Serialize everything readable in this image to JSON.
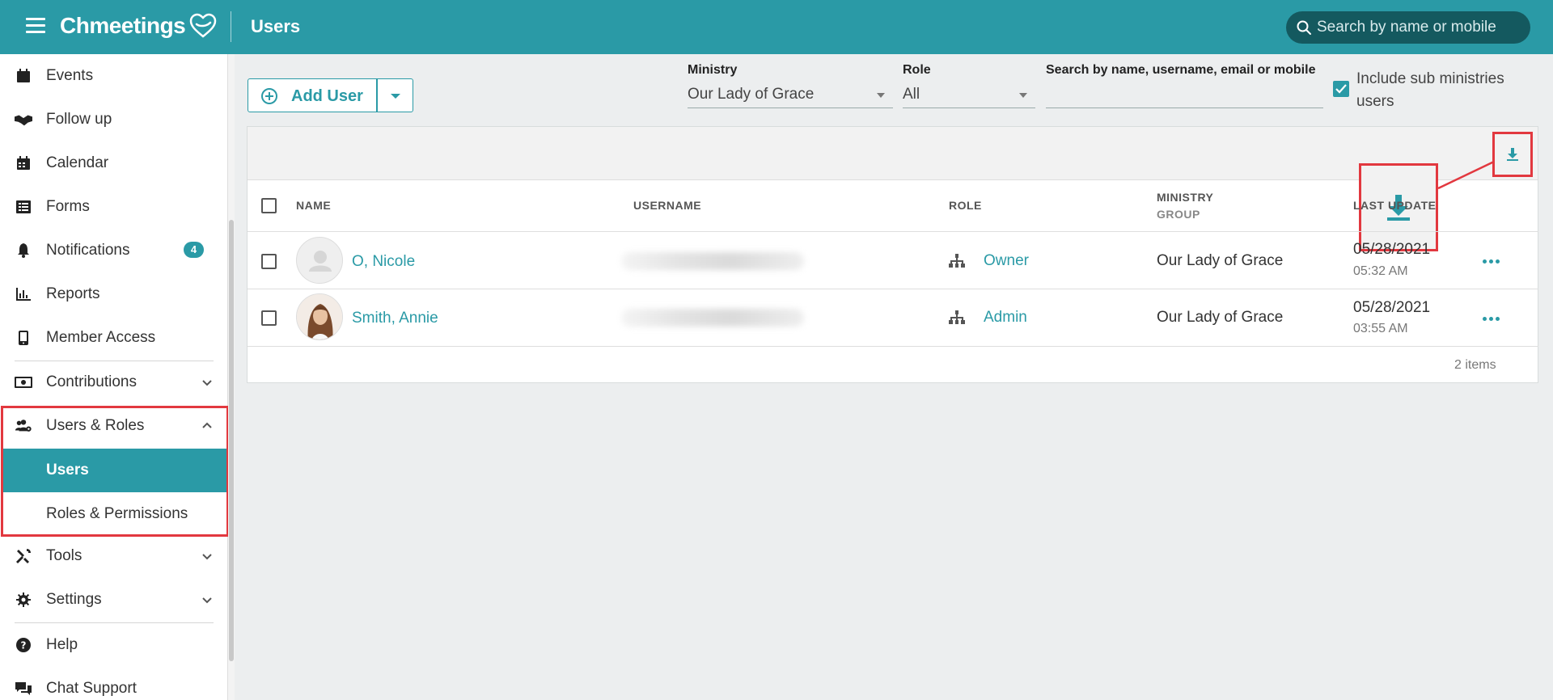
{
  "app": {
    "logo_text": "Chmeetings",
    "page_title": "Users",
    "search_placeholder": "Search by name or mobile"
  },
  "sidebar": {
    "items": [
      {
        "label": "Events",
        "icon": "calendar-page-icon"
      },
      {
        "label": "Follow up",
        "icon": "handshake-icon"
      },
      {
        "label": "Calendar",
        "icon": "calendar-icon"
      },
      {
        "label": "Forms",
        "icon": "form-list-icon"
      },
      {
        "label": "Notifications",
        "icon": "bell-icon",
        "badge": "4"
      },
      {
        "label": "Reports",
        "icon": "bar-chart-icon"
      },
      {
        "label": "Member Access",
        "icon": "mobile-phone-icon"
      },
      {
        "label": "Contributions",
        "icon": "money-icon"
      },
      {
        "label": "Users & Roles",
        "icon": "users-cog-icon"
      },
      {
        "label": "Tools",
        "icon": "tools-icon"
      },
      {
        "label": "Settings",
        "icon": "gear-icon"
      },
      {
        "label": "Help",
        "icon": "question-circle-icon"
      },
      {
        "label": "Chat Support",
        "icon": "chat-bubbles-icon"
      }
    ],
    "users_roles_sub": [
      {
        "label": "Users",
        "active": true
      },
      {
        "label": "Roles & Permissions",
        "active": false
      }
    ]
  },
  "toolbar": {
    "add_user_label": "Add User",
    "ministry_label": "Ministry",
    "ministry_value": "Our Lady of Grace",
    "role_label": "Role",
    "role_value": "All",
    "search_label": "Search by name, username, email or mobile",
    "search_value": "",
    "include_sub_label": "Include sub ministries users",
    "include_sub_checked": true
  },
  "table": {
    "columns": {
      "name": "NAME",
      "username": "USERNAME",
      "role": "ROLE",
      "ministry": "MINISTRY",
      "ministry_sub": "GROUP",
      "last_update": "LAST UPDATE"
    },
    "rows": [
      {
        "name": "O, Nicole",
        "username": "(blurred)",
        "role": "Owner",
        "ministry": "Our Lady of Grace",
        "date": "05/28/2021",
        "time": "05:32 AM"
      },
      {
        "name": "Smith, Annie",
        "username": "(blurred)",
        "role": "Admin",
        "ministry": "Our Lady of Grace",
        "date": "05/28/2021",
        "time": "03:55 AM"
      }
    ],
    "items_count": "2 items"
  },
  "colors": {
    "brand": "#2a9aa6",
    "highlight": "#e2383f"
  }
}
